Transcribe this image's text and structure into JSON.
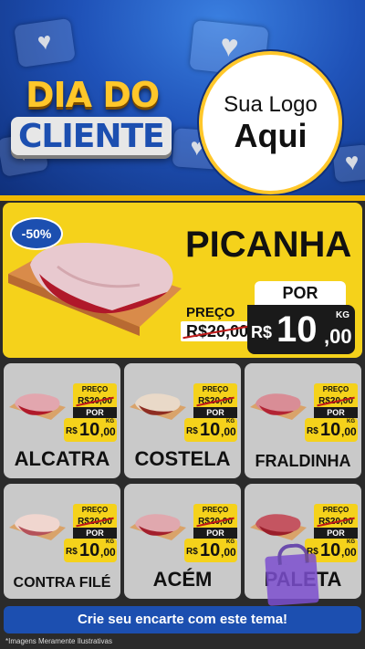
{
  "header": {
    "title_line1": "DIA DO",
    "title_line2": "CLIENTE",
    "logo_line1": "Sua Logo",
    "logo_line2": "Aqui"
  },
  "hero": {
    "discount": "-50%",
    "name": "PICANHA",
    "por": "POR",
    "preco_label": "PREÇO",
    "old_price": "R$20,00",
    "currency": "R$",
    "price_int": "10",
    "price_dec": ",00",
    "unit": "KG"
  },
  "products": [
    {
      "name": "ALCATRA",
      "preco_label": "PREÇO",
      "old_price": "R$20,00",
      "por": "POR",
      "currency": "R$",
      "price_int": "10",
      "price_dec": ",00",
      "unit": "KG"
    },
    {
      "name": "COSTELA",
      "preco_label": "PREÇO",
      "old_price": "R$20,00",
      "por": "POR",
      "currency": "R$",
      "price_int": "10",
      "price_dec": ",00",
      "unit": "KG"
    },
    {
      "name": "FRALDINHA",
      "preco_label": "PREÇO",
      "old_price": "R$20,00",
      "por": "POR",
      "currency": "R$",
      "price_int": "10",
      "price_dec": ",00",
      "unit": "KG"
    },
    {
      "name": "CONTRA FILÉ",
      "preco_label": "PREÇO",
      "old_price": "R$20,00",
      "por": "POR",
      "currency": "R$",
      "price_int": "10",
      "price_dec": ",00",
      "unit": "KG"
    },
    {
      "name": "ACÉM",
      "preco_label": "PREÇO",
      "old_price": "R$20,00",
      "por": "POR",
      "currency": "R$",
      "price_int": "10",
      "price_dec": ",00",
      "unit": "KG"
    },
    {
      "name": "PALETA",
      "preco_label": "PREÇO",
      "old_price": "R$20,00",
      "por": "POR",
      "currency": "R$",
      "price_int": "10",
      "price_dec": ",00",
      "unit": "KG"
    }
  ],
  "cta": "Crie seu encarte com este tema!",
  "footnote": "*Imagens Meramente Ilustrativas",
  "colors": {
    "yellow": "#f5d21b",
    "blue": "#1c4fb0",
    "gold": "#ffc72a",
    "dark": "#1a1a1a",
    "card": "#c9c9c9"
  },
  "icons": {
    "header_deco": "heart-icon",
    "product_image": "meat-cut-icon",
    "bag": "shopping-bag-icon"
  }
}
